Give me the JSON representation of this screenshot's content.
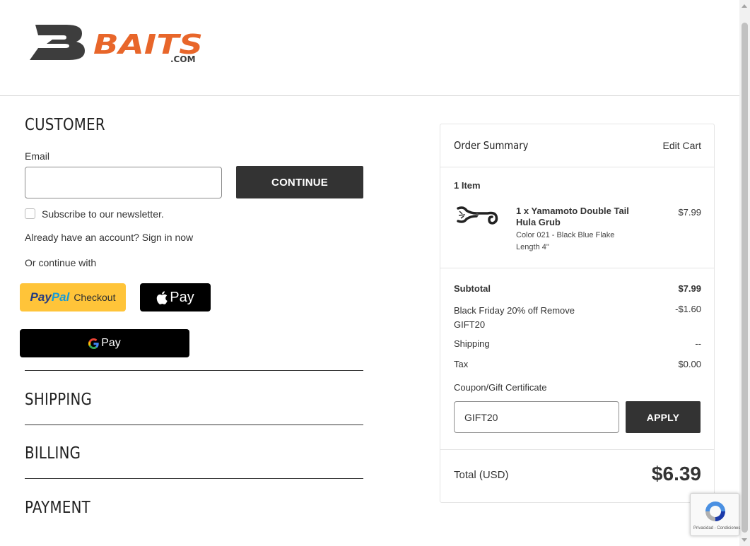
{
  "brand": {
    "logo_text": "BAITS",
    "logo_suffix": ".COM",
    "colors": {
      "orange": "#e8662a",
      "dark": "#3d3d3d"
    }
  },
  "customer": {
    "title": "CUSTOMER",
    "email_label": "Email",
    "email_value": "",
    "continue_label": "CONTINUE",
    "newsletter_label": "Subscribe to our newsletter.",
    "signin_text": "Already have an account? Sign in now",
    "or_continue": "Or continue with",
    "paypal": {
      "word1": "Pay",
      "word2": "Pal",
      "checkout": "Checkout"
    },
    "applepay_label": "Pay",
    "gpay_label": "Pay"
  },
  "sections": {
    "shipping": "SHIPPING",
    "billing": "BILLING",
    "payment": "PAYMENT"
  },
  "order_summary": {
    "title": "Order Summary",
    "edit_cart": "Edit Cart",
    "item_count": "1 Item",
    "items": [
      {
        "name": "1 x Yamamoto Double Tail Hula Grub",
        "price": "$7.99",
        "options": [
          "Color 021 - Black Blue Flake",
          "Length 4\""
        ]
      }
    ],
    "subtotal_label": "Subtotal",
    "subtotal_value": "$7.99",
    "discount_label": "Black Friday 20% off Remove GIFT20",
    "discount_value": "-$1.60",
    "shipping_label": "Shipping",
    "shipping_value": "--",
    "tax_label": "Tax",
    "tax_value": "$0.00",
    "coupon_label": "Coupon/Gift Certificate",
    "coupon_value": "GIFT20",
    "apply_label": "APPLY",
    "total_label": "Total (USD)",
    "total_value": "$6.39"
  },
  "recaptcha": {
    "text": "Privacidad - Condiciones"
  }
}
